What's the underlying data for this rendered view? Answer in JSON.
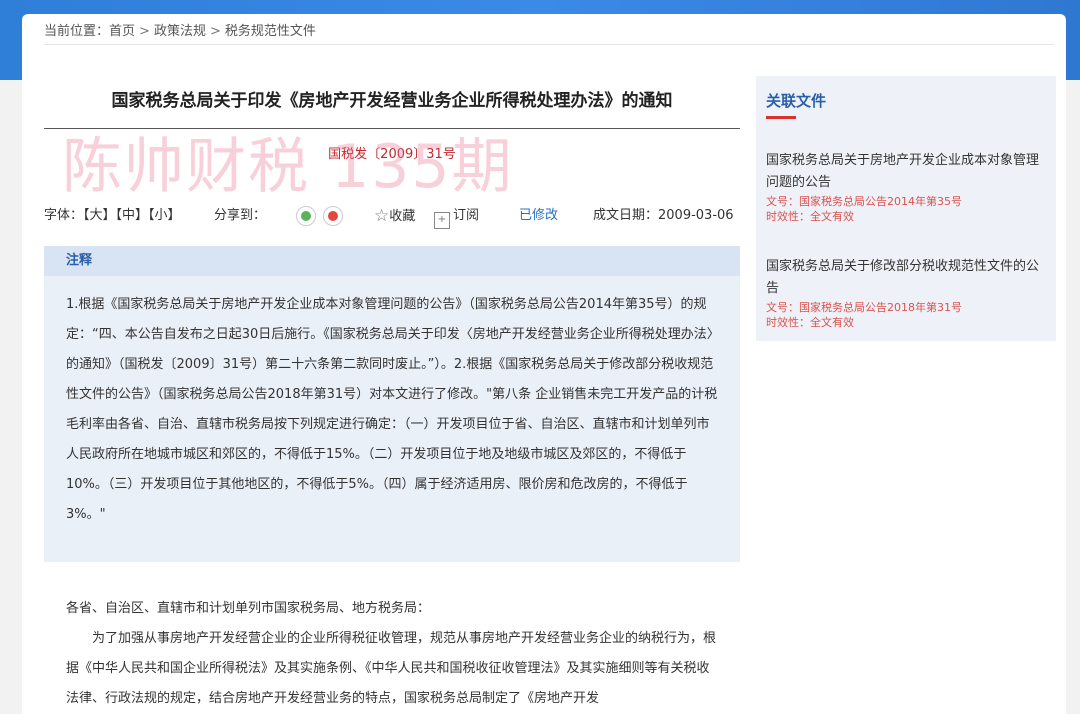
{
  "breadcrumb": {
    "prefix": "当前位置：",
    "items": [
      "首页",
      "政策法规",
      "税务规范性文件"
    ],
    "separator": ">"
  },
  "article": {
    "title": "国家税务总局关于印发《房地产开发经营业务企业所得税处理办法》的通知",
    "doc_number": "国税发〔2009〕31号"
  },
  "toolbar": {
    "font_label": "字体：",
    "font_large": "【大】",
    "font_medium": "【中】",
    "font_small": "【小】",
    "share_label": "分享到：",
    "favorite": "收藏",
    "subscribe": "订阅",
    "modified": "已修改",
    "date_label": "成文日期：",
    "date": "2009-03-06"
  },
  "watermark": "陈帅财税 135期",
  "note": {
    "heading": "注释",
    "text": "1.根据《国家税务总局关于房地产开发企业成本对象管理问题的公告》（国家税务总局公告2014年第35号）的规定：“四、本公告自发布之日起30日后施行。《国家税务总局关于印发〈房地产开发经营业务企业所得税处理办法〉的通知》（国税发〔2009〕31号）第二十六条第二款同时废止。”）。2.根据《国家税务总局关于修改部分税收规范性文件的公告》（国家税务总局公告2018年第31号）对本文进行了修改。\"第八条 企业销售未完工开发产品的计税毛利率由各省、自治、直辖市税务局按下列规定进行确定：（一）开发项目位于省、自治区、直辖市和计划单列市人民政府所在地城市城区和郊区的，不得低于15%。（二）开发项目位于地及地级市城区及郊区的，不得低于10%。（三）开发项目位于其他地区的，不得低于5%。（四）属于经济适用房、限价房和危改房的，不得低于3%。\""
  },
  "body": {
    "salutation": "各省、自治区、直辖市和计划单列市国家税务局、地方税务局：",
    "paragraph": "为了加强从事房地产开发经营企业的企业所得税征收管理，规范从事房地产开发经营业务企业的纳税行为，根据《中华人民共和国企业所得税法》及其实施条例、《中华人民共和国税收征收管理法》及其实施细则等有关税收法律、行政法规的规定，结合房地产开发经营业务的特点，国家税务总局制定了《房地产开发"
  },
  "sidebar": {
    "title": "关联文件",
    "items": [
      {
        "title": "国家税务总局关于房地产开发企业成本对象管理问题的公告",
        "doc_no": "文号：国家税务总局公告2014年第35号",
        "validity": "时效性：全文有效"
      },
      {
        "title": "国家税务总局关于修改部分税收规范性文件的公告",
        "doc_no": "文号：国家税务总局公告2018年第31号",
        "validity": "时效性：全文有效"
      }
    ]
  },
  "colors": {
    "accent_blue": "#2a5fa8",
    "doc_red": "#c0282e",
    "header_blue": "#2f7ed8"
  }
}
